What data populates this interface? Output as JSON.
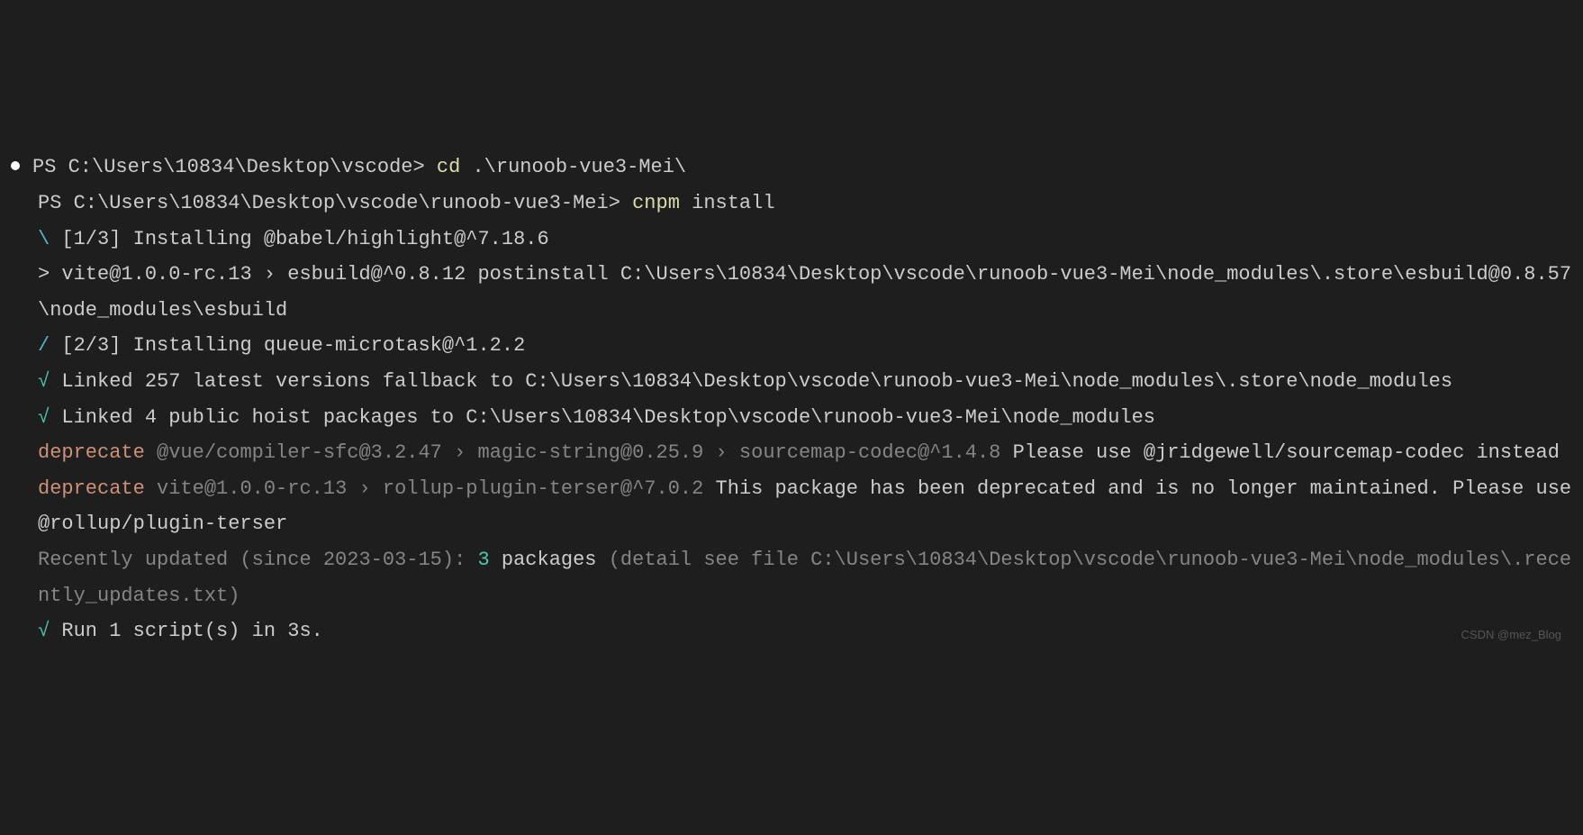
{
  "lines": {
    "l1_prompt": "PS C:\\Users\\10834\\Desktop\\vscode> ",
    "l1_cmd": "cd",
    "l1_arg": " .\\runoob-vue3-Mei\\",
    "l2_prompt": "PS C:\\Users\\10834\\Desktop\\vscode\\runoob-vue3-Mei> ",
    "l2_cmd": "cnpm",
    "l2_arg": " install",
    "l3_spinner": "\\ ",
    "l3_text": "[1/3] Installing @babel/highlight@^7.18.6",
    "l4_arrow": "> ",
    "l4_text": "vite@1.0.0-rc.13 › esbuild@^0.8.12 postinstall C:\\Users\\10834\\Desktop\\vscode\\runoob-vue3-Mei\\node_modules\\.store\\esbuild@0.8.57\\node_modules\\esbuild",
    "l5_spinner": "/ ",
    "l5_text": "[2/3] Installing queue-microtask@^1.2.2",
    "l6_check": "√ ",
    "l6_text": "Linked 257 latest versions fallback to C:\\Users\\10834\\Desktop\\vscode\\runoob-vue3-Mei\\node_modules\\.store\\node_modules",
    "l7_check": "√ ",
    "l7_text": "Linked 4 public hoist packages to C:\\Users\\10834\\Desktop\\vscode\\runoob-vue3-Mei\\node_modules",
    "l8_dep": "deprecate ",
    "l8_dim": "@vue/compiler-sfc@3.2.47 › magic-string@0.25.9 › sourcemap-codec@^1.4.8 ",
    "l8_text": "Please use @jridgewell/sourcemap-codec instead",
    "l9_dep": "deprecate ",
    "l9_dim": "vite@1.0.0-rc.13 › rollup-plugin-terser@^7.0.2 ",
    "l9_text": "This package has been deprecated and is no longer maintained. Please use @rollup/plugin-terser",
    "l10_dim1": "Recently updated (since 2023-03-15): ",
    "l10_num": "3",
    "l10_white": " packages ",
    "l10_dim2": "(detail see file C:\\Users\\10834\\Desktop\\vscode\\runoob-vue3-Mei\\node_modules\\.recently_updates.txt)",
    "l11_check": "√ ",
    "l11_text": "Run 1 script(s) in 3s."
  },
  "watermark": "CSDN @mez_Blog"
}
